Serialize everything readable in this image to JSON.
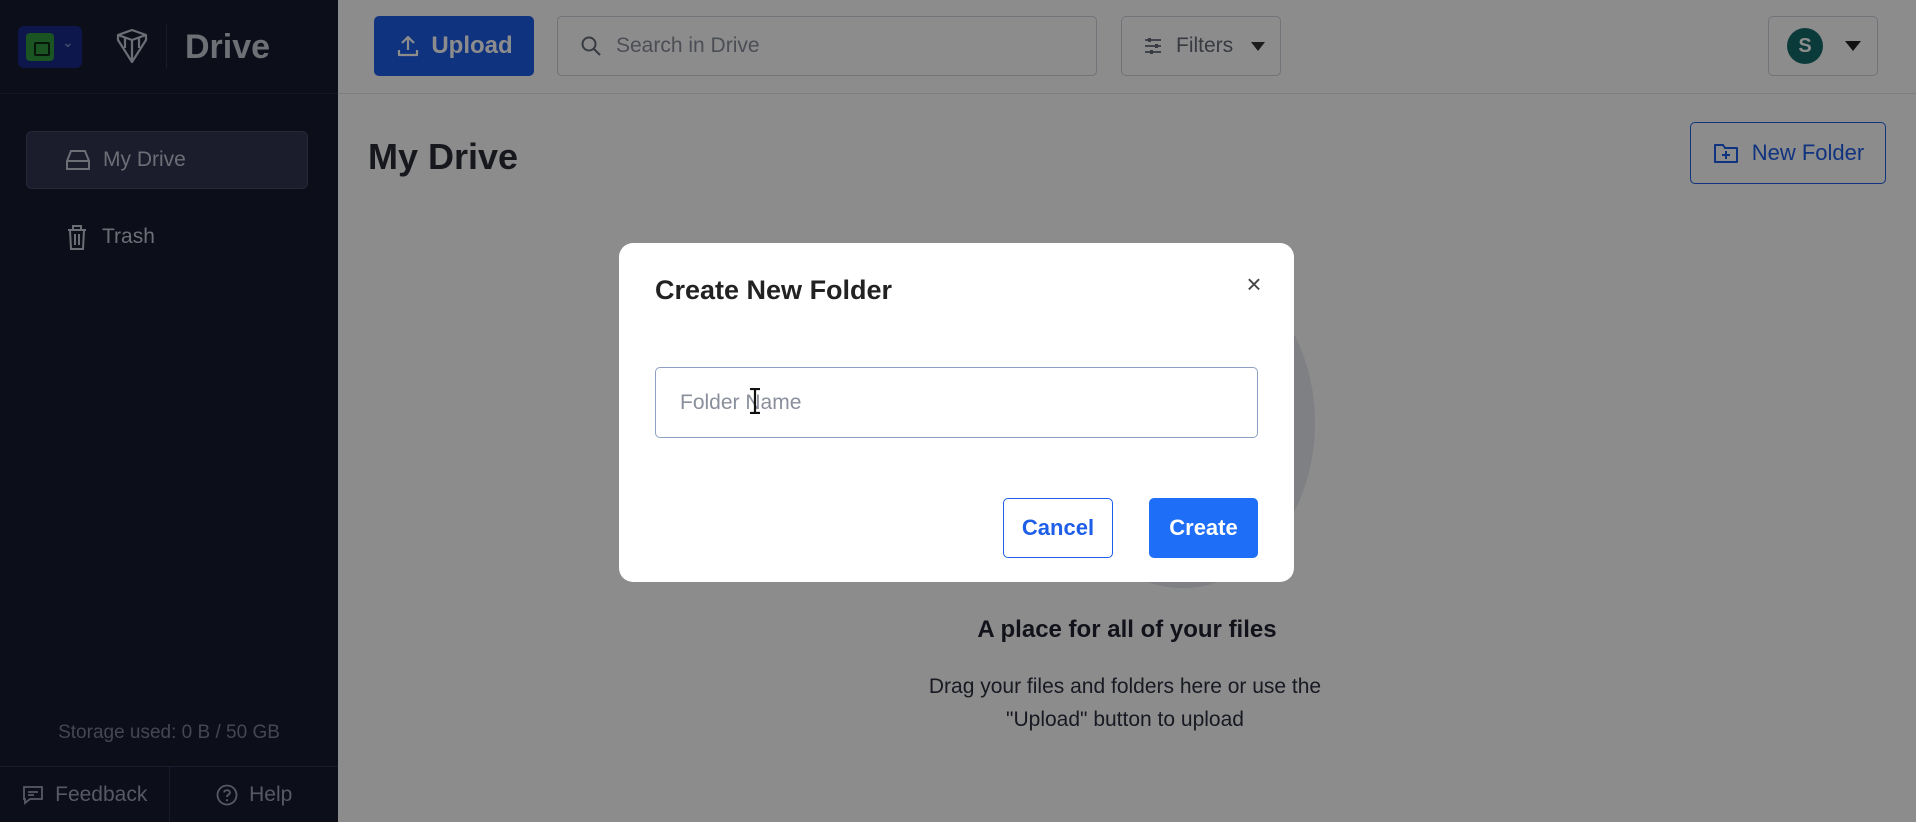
{
  "sidebar": {
    "brand_name": "Drive",
    "nav": [
      {
        "label": "My Drive",
        "icon": "drive-icon",
        "active": true
      },
      {
        "label": "Trash",
        "icon": "trash-icon",
        "active": false
      }
    ],
    "storage": "Storage used: 0 B / 50 GB",
    "feedback_label": "Feedback",
    "help_label": "Help"
  },
  "topbar": {
    "upload_label": "Upload",
    "search_placeholder": "Search in Drive",
    "filters_label": "Filters",
    "avatar_initial": "S"
  },
  "main": {
    "page_title": "My Drive",
    "new_folder_label": "New Folder",
    "empty_title": "A place for all of your files",
    "empty_text": "Drag your files and folders here or use the \"Upload\" button to upload"
  },
  "modal": {
    "title": "Create New Folder",
    "close_glyph": "×",
    "input_placeholder": "Folder Name",
    "cancel_label": "Cancel",
    "create_label": "Create"
  },
  "colors": {
    "sidebar_bg": "#161a30",
    "accent": "#1e5ee8",
    "create_button": "#1f6ef7",
    "avatar": "#146a6c"
  }
}
